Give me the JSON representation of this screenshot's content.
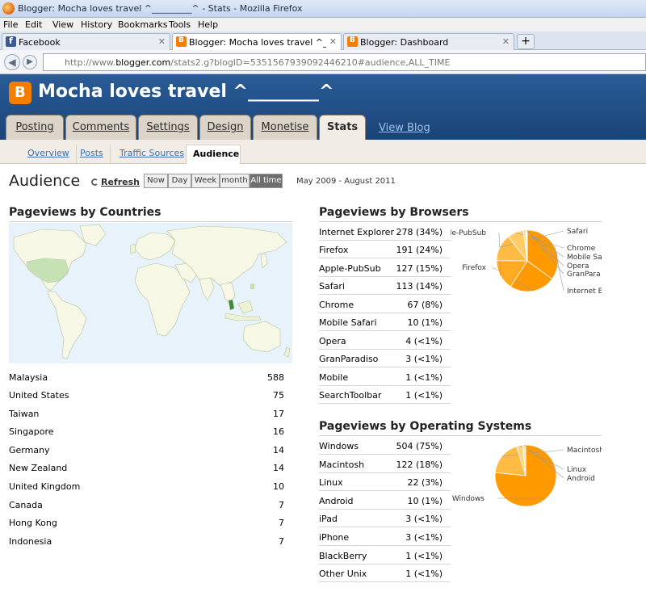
{
  "window": {
    "title": "Blogger: Mocha loves travel ^_________^ - Stats - Mozilla Firefox"
  },
  "menu": [
    "File",
    "Edit",
    "View",
    "History",
    "Bookmarks",
    "Tools",
    "Help"
  ],
  "tabs": [
    {
      "label": "Facebook"
    },
    {
      "label": "Blogger: Mocha loves travel ^_____"
    },
    {
      "label": "Blogger: Dashboard"
    }
  ],
  "newtab_symbol": "+",
  "address": {
    "prefix": "http://www.",
    "domain": "blogger.com",
    "path": "/stats2.g?blogID=5351567939092446210#audience,ALL_TIME"
  },
  "blog": {
    "name": "Mocha loves travel ^________^"
  },
  "main_tabs": [
    "Posting",
    "Comments",
    "Settings",
    "Design",
    "Monetise",
    "Stats"
  ],
  "view_blog": "View Blog",
  "sub_tabs": [
    "Overview",
    "Posts",
    "Traffic Sources",
    "Audience"
  ],
  "page": {
    "title": "Audience",
    "refresh": "Refresh",
    "ranges": [
      "Now",
      "Day",
      "Week",
      "month",
      "All time"
    ],
    "date_range": "May 2009 - August 2011"
  },
  "countries": {
    "title": "Pageviews by Countries",
    "rows": [
      {
        "name": "Malaysia",
        "value": "588"
      },
      {
        "name": "United States",
        "value": "75"
      },
      {
        "name": "Taiwan",
        "value": "17"
      },
      {
        "name": "Singapore",
        "value": "16"
      },
      {
        "name": "Germany",
        "value": "14"
      },
      {
        "name": "New Zealand",
        "value": "14"
      },
      {
        "name": "United Kingdom",
        "value": "10"
      },
      {
        "name": "Canada",
        "value": "7"
      },
      {
        "name": "Hong Kong",
        "value": "7"
      },
      {
        "name": "Indonesia",
        "value": "7"
      }
    ]
  },
  "browsers": {
    "title": "Pageviews by Browsers",
    "rows": [
      {
        "name": "Internet Explorer",
        "value": "278 (34%)"
      },
      {
        "name": "Firefox",
        "value": "191 (24%)"
      },
      {
        "name": "Apple-PubSub",
        "value": "127 (15%)"
      },
      {
        "name": "Safari",
        "value": "113 (14%)"
      },
      {
        "name": "Chrome",
        "value": "67 (8%)"
      },
      {
        "name": "Mobile Safari",
        "value": "10 (1%)"
      },
      {
        "name": "Opera",
        "value": "4 (<1%)"
      },
      {
        "name": "GranParadiso",
        "value": "3 (<1%)"
      },
      {
        "name": "Mobile",
        "value": "1 (<1%)"
      },
      {
        "name": "SearchToolbar",
        "value": "1 (<1%)"
      }
    ]
  },
  "os": {
    "title": "Pageviews by Operating Systems",
    "rows": [
      {
        "name": "Windows",
        "value": "504 (75%)"
      },
      {
        "name": "Macintosh",
        "value": "122 (18%)"
      },
      {
        "name": "Linux",
        "value": "22 (3%)"
      },
      {
        "name": "Android",
        "value": "10 (1%)"
      },
      {
        "name": "iPad",
        "value": "3 (<1%)"
      },
      {
        "name": "iPhone",
        "value": "3 (<1%)"
      },
      {
        "name": "BlackBerry",
        "value": "1 (<1%)"
      },
      {
        "name": "Other Unix",
        "value": "1 (<1%)"
      }
    ]
  },
  "chart_data": [
    {
      "type": "pie",
      "labels": [
        "Internet E",
        "Firefox",
        "le-PubSub",
        "Safari",
        "Chrome",
        "Mobile Sa",
        "Opera",
        "GranPara"
      ],
      "values": [
        278,
        191,
        127,
        113,
        67,
        10,
        4,
        3
      ],
      "colors": [
        "#ff9900",
        "#ff9900",
        "#ffaa22",
        "#ffbb44",
        "#ffcc66",
        "#ffdd88",
        "#ffe6a6",
        "#fff0c8"
      ]
    },
    {
      "type": "pie",
      "labels": [
        "Windows",
        "Macintosh",
        "Linux",
        "Android"
      ],
      "values": [
        504,
        122,
        22,
        10
      ],
      "colors": [
        "#ff9900",
        "#ffbb44",
        "#ffd680",
        "#ffe6a6"
      ]
    }
  ],
  "colors": {
    "header_bg": "#1f4d82",
    "map_water": "#e8f2fb",
    "accent": "#ff9900",
    "link": "#3a6fb0"
  }
}
